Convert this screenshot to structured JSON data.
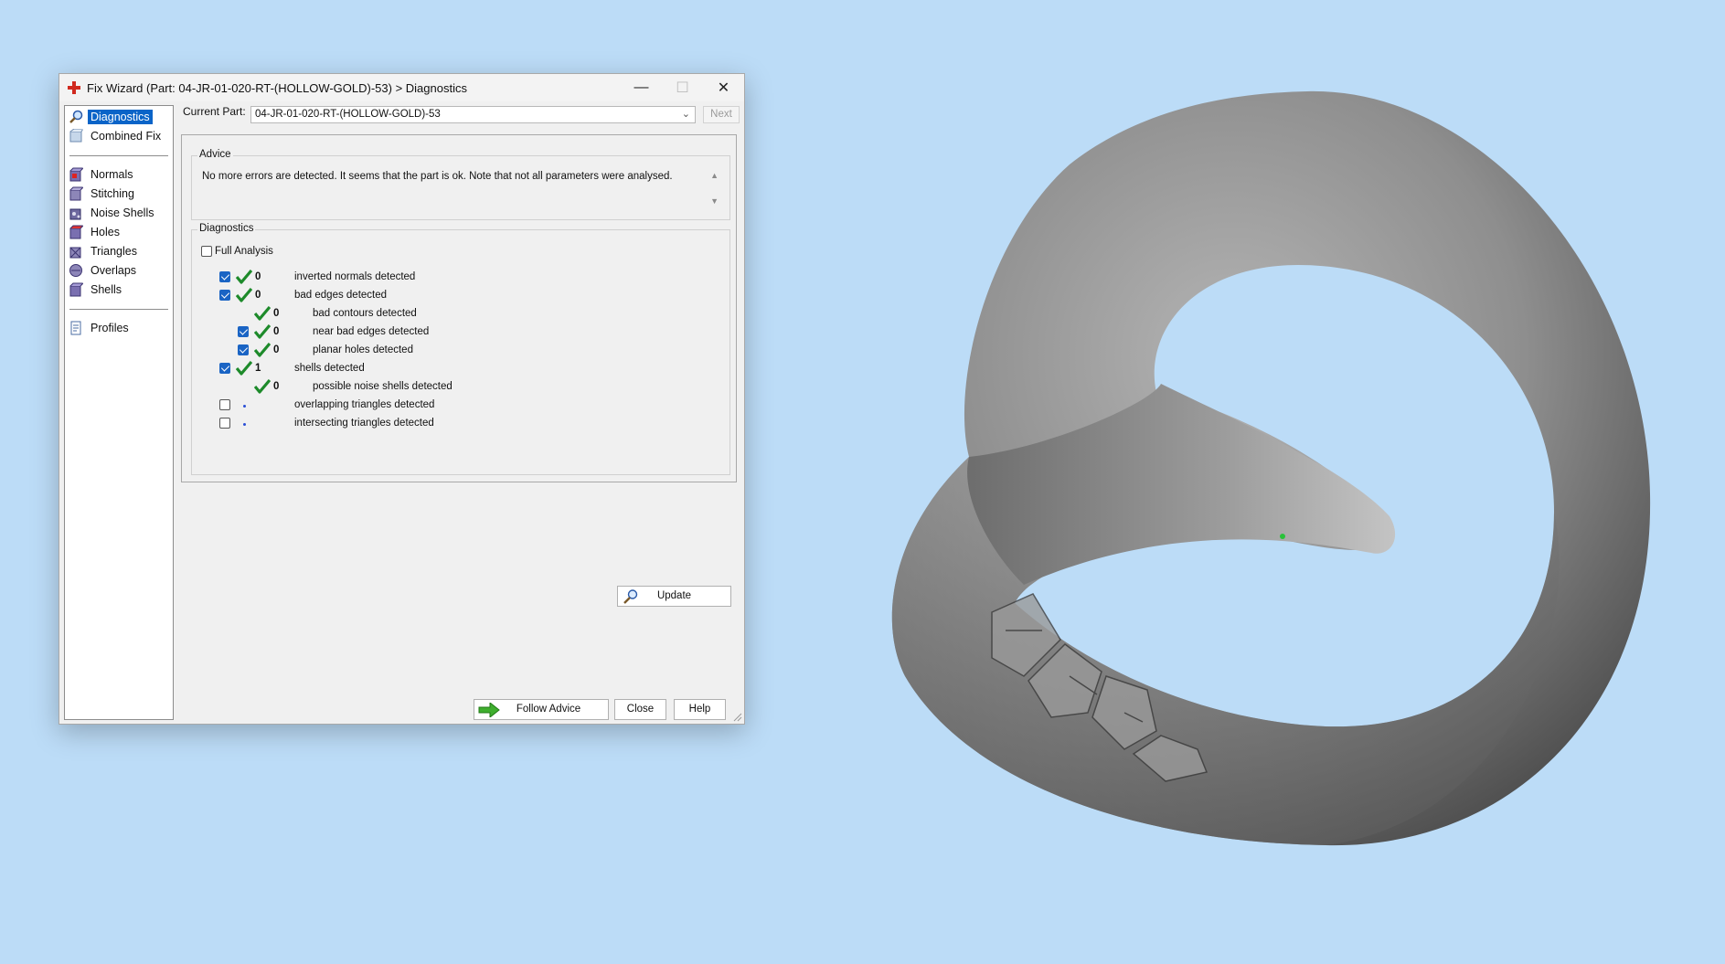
{
  "window": {
    "title": "Fix Wizard (Part: 04-JR-01-020-RT-(HOLLOW-GOLD)-53) > Diagnostics",
    "minimize_glyph": "—",
    "maximize_glyph": "☐",
    "close_glyph": "✕"
  },
  "nav": {
    "top_items": [
      {
        "label": "Diagnostics",
        "icon": "magnifier-icon",
        "active": true
      },
      {
        "label": "Combined Fix",
        "icon": "combined-fix-icon",
        "active": false
      }
    ],
    "fix_items": [
      {
        "label": "Normals",
        "icon": "normals-icon"
      },
      {
        "label": "Stitching",
        "icon": "stitching-icon"
      },
      {
        "label": "Noise Shells",
        "icon": "noise-shells-icon"
      },
      {
        "label": "Holes",
        "icon": "holes-icon"
      },
      {
        "label": "Triangles",
        "icon": "triangles-icon"
      },
      {
        "label": "Overlaps",
        "icon": "overlaps-icon"
      },
      {
        "label": "Shells",
        "icon": "shells-icon"
      }
    ],
    "bottom_items": [
      {
        "label": "Profiles",
        "icon": "profiles-icon"
      }
    ]
  },
  "current_part": {
    "label": "Current Part:",
    "value": "04-JR-01-020-RT-(HOLLOW-GOLD)-53",
    "next_label": "Next"
  },
  "advice": {
    "title": "Advice",
    "text": "No more errors are detected. It seems that the part is ok. Note that not all parameters were analysed."
  },
  "diagnostics": {
    "title": "Diagnostics",
    "full_analysis_label": "Full Analysis",
    "full_analysis_checked": false,
    "rows": [
      {
        "indent": 0,
        "checkbox": true,
        "checked": true,
        "status": "ok",
        "count": "0",
        "text": "inverted normals detected"
      },
      {
        "indent": 0,
        "checkbox": true,
        "checked": true,
        "status": "ok",
        "count": "0",
        "text": "bad edges detected"
      },
      {
        "indent": 1,
        "checkbox": false,
        "checked": false,
        "status": "ok",
        "count": "0",
        "text": "bad contours detected"
      },
      {
        "indent": 1,
        "checkbox": true,
        "checked": true,
        "status": "ok",
        "count": "0",
        "text": "near bad edges detected"
      },
      {
        "indent": 1,
        "checkbox": true,
        "checked": true,
        "status": "ok",
        "count": "0",
        "text": "planar holes detected"
      },
      {
        "indent": 0,
        "checkbox": true,
        "checked": true,
        "status": "ok",
        "count": "1",
        "text": "shells detected"
      },
      {
        "indent": 1,
        "checkbox": false,
        "checked": false,
        "status": "ok",
        "count": "0",
        "text": "possible noise shells detected"
      },
      {
        "indent": 0,
        "checkbox": true,
        "checked": false,
        "status": "pending",
        "count": "",
        "text": "overlapping triangles detected"
      },
      {
        "indent": 0,
        "checkbox": true,
        "checked": false,
        "status": "pending",
        "count": "",
        "text": "intersecting triangles detected"
      }
    ],
    "update_label": "Update"
  },
  "buttons": {
    "follow_advice": "Follow Advice",
    "close": "Close",
    "help": "Help"
  },
  "colors": {
    "viewport_bg": "#bcdcf7",
    "selection": "#0a64c8",
    "check_green": "#1d8a2a"
  }
}
